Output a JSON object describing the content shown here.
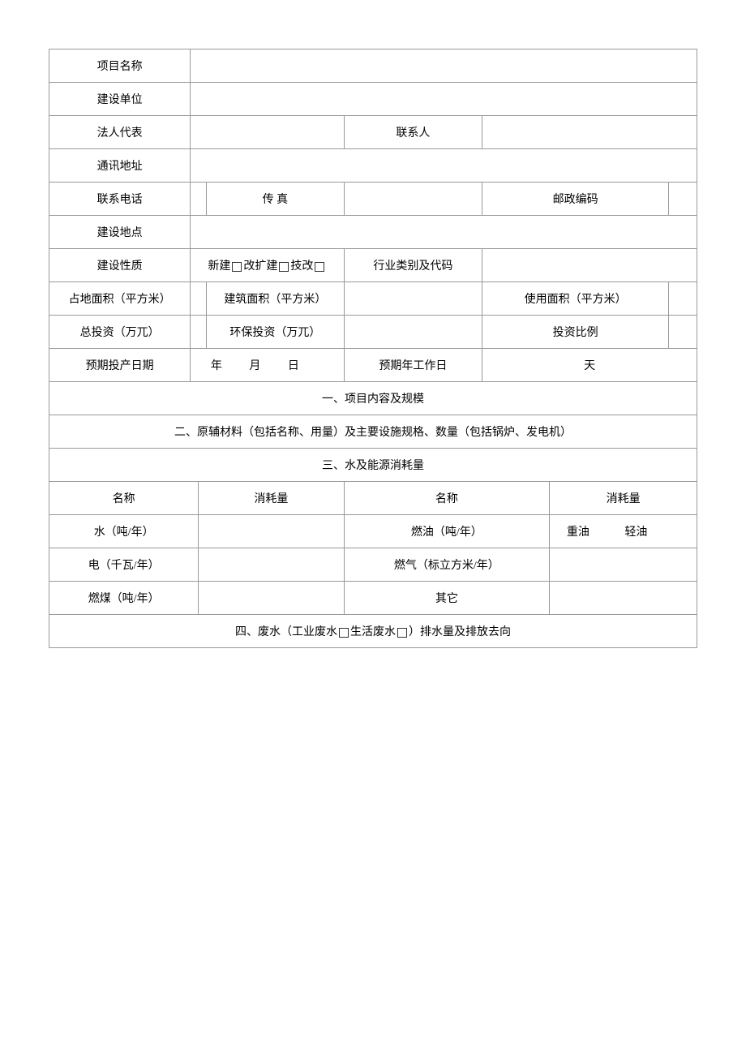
{
  "labels": {
    "project_name": "项目名称",
    "construction_unit": "建设单位",
    "legal_rep": "法人代表",
    "contact_person": "联系人",
    "address": "通讯地址",
    "phone": "联系电话",
    "fax": "传 真",
    "postal_code": "邮政编码",
    "construction_site": "建设地点",
    "construction_nature": "建设性质",
    "nature_new": "新建",
    "nature_expand": "改扩建",
    "nature_tech": "技改",
    "industry_category": "行业类别及代码",
    "land_area": "占地面积（平方米）",
    "building_area": "建筑面积（平方米）",
    "usable_area": "使用面积（平方米）",
    "total_investment": "总投资（万兀）",
    "env_investment": "环保投资（万兀）",
    "investment_ratio": "投资比例",
    "expected_production": "预期投产日期",
    "year": "年",
    "month": "月",
    "day": "日",
    "expected_work_days": "预期年工作日",
    "days_unit": "天",
    "section1": "一、项目内容及规模",
    "section2": "二、原辅材料（包括名称、用量）及主要设施规格、数量（包括锅炉、发电机）",
    "section3": "三、水及能源消耗量",
    "col_name": "名称",
    "col_consumption": "消耗量",
    "water": "水（吨/年）",
    "fuel_oil": "燃油（吨/年）",
    "heavy_oil": "重油",
    "light_oil": "轻油",
    "electricity": "电（千瓦/年）",
    "gas": "燃气（标立方米/年）",
    "coal": "燃煤（吨/年）",
    "other": "其它",
    "section4_prefix": "四、废水（工业废水",
    "section4_mid": "生活废水",
    "section4_suffix": "）排水量及排放去向"
  }
}
